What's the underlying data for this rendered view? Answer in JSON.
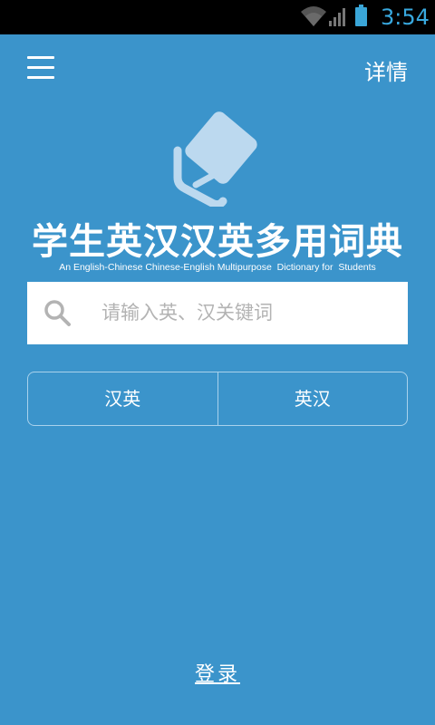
{
  "status_bar": {
    "time": "3:54",
    "icons": [
      "wifi-icon",
      "signal-icon",
      "battery-icon"
    ],
    "accent_color": "#38a8de"
  },
  "header": {
    "menu_icon": "hamburger-menu-icon",
    "detail_label": "详情"
  },
  "logo": {
    "icon": "book-logo-icon"
  },
  "title": {
    "main": "学生英汉汉英多用词典",
    "subtitle": "An English-Chinese Chinese-English Multipurpose  Dictionary for  Students"
  },
  "search": {
    "icon": "search-icon",
    "value": "",
    "placeholder": "请输入英、汉关键词"
  },
  "mode_toggle": {
    "options": [
      {
        "label": "汉英"
      },
      {
        "label": "英汉"
      }
    ]
  },
  "footer": {
    "login_label": "登录"
  },
  "colors": {
    "background": "#3b94cb",
    "status_bar": "#000000",
    "search_field": "#ffffff",
    "placeholder": "#b3b3b3",
    "segment_border": "#a9d2ec"
  }
}
